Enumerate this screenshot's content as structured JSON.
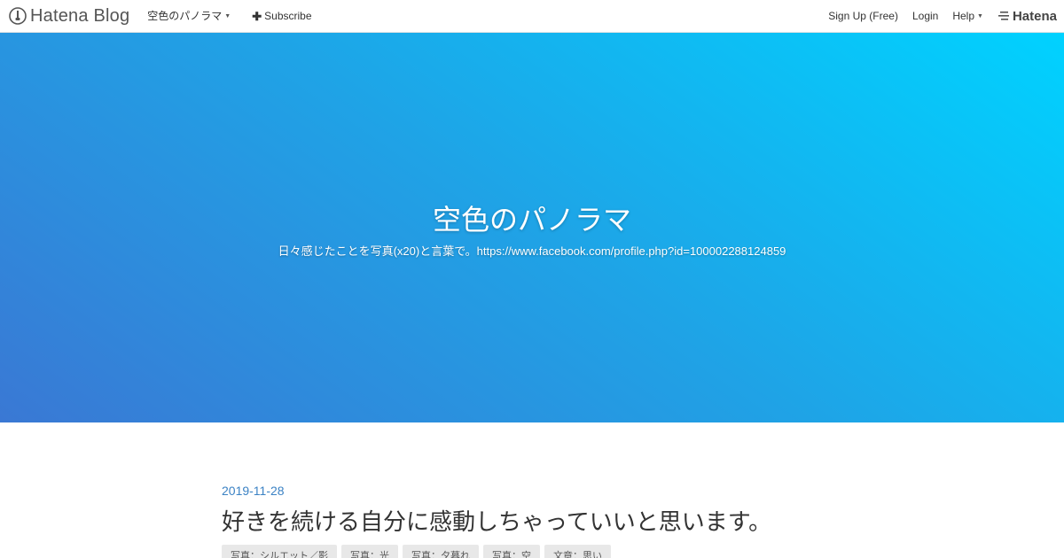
{
  "topbar": {
    "brand": "Hatena Blog",
    "blog_menu_label": "空色のパノラマ",
    "subscribe_label": "Subscribe",
    "signup_label": "Sign Up (Free)",
    "login_label": "Login",
    "help_label": "Help",
    "hatena_label": "Hatena"
  },
  "header": {
    "title": "空色のパノラマ",
    "description": "日々感じたことを写真(x20)と言葉で。https://www.facebook.com/profile.php?id=100002288124859"
  },
  "entry": {
    "date": "2019-11-28",
    "title": "好きを続ける自分に感動しちゃっていいと思います。",
    "categories": [
      "写真：シルエット／影",
      "写真：光",
      "写真：夕暮れ",
      "写真：空",
      "文章：思い"
    ]
  },
  "colors": {
    "accent_link": "#3b82c4",
    "hero_gradient_start": "#3a78d4",
    "hero_gradient_end": "#00d2ff"
  }
}
